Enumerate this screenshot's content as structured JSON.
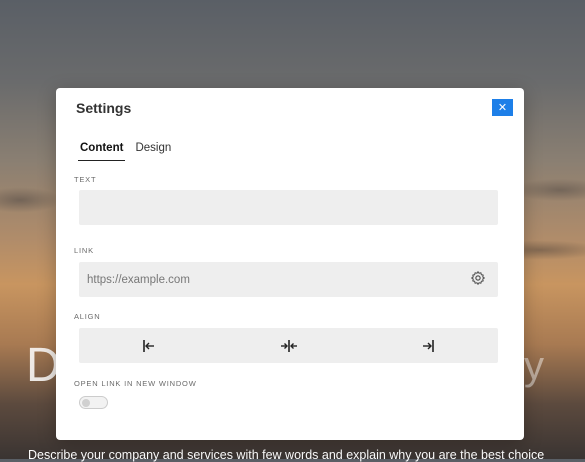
{
  "background": {
    "hero_heading_left": "D",
    "hero_heading_right": "y",
    "hero_description": "Describe your company and services with few words and explain why you are the best choice"
  },
  "modal": {
    "title": "Settings",
    "close_icon": "close-icon",
    "tabs": [
      {
        "label": "Content",
        "active": true
      },
      {
        "label": "Design",
        "active": false
      }
    ],
    "text_section": {
      "label": "TEXT",
      "value": ""
    },
    "link_section": {
      "label": "LINK",
      "placeholder": "https://example.com",
      "value": "",
      "settings_icon": "gear-icon"
    },
    "align_section": {
      "label": "ALIGN",
      "options": [
        {
          "name": "align-left",
          "icon": "align-left-icon"
        },
        {
          "name": "align-center",
          "icon": "align-center-icon"
        },
        {
          "name": "align-right",
          "icon": "align-right-icon"
        }
      ]
    },
    "new_window_section": {
      "label": "OPEN LINK IN NEW WINDOW",
      "enabled": false
    }
  },
  "colors": {
    "accent": "#1d7fe8",
    "field_bg": "#eeeeee",
    "modal_bg": "#ffffff"
  }
}
